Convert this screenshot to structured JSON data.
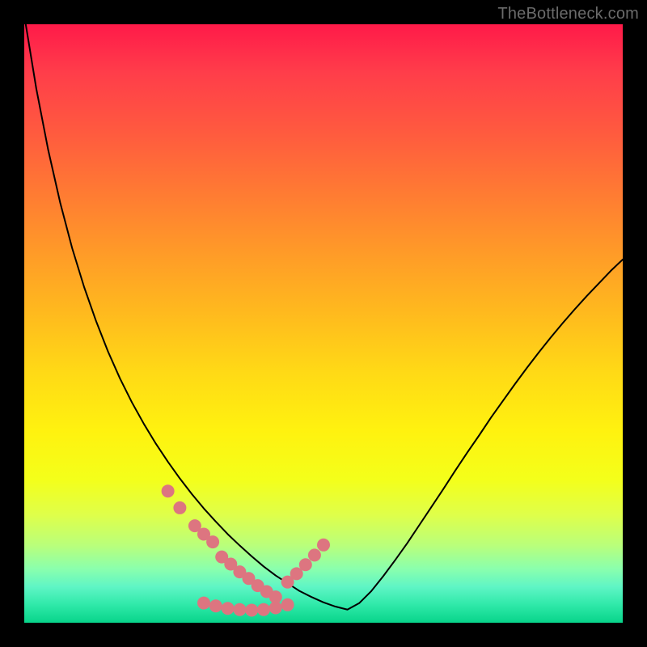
{
  "watermark": "TheBottleneck.com",
  "chart_data": {
    "type": "line",
    "title": "",
    "xlabel": "",
    "ylabel": "",
    "xlim": [
      0,
      1
    ],
    "ylim": [
      0,
      1
    ],
    "series": [
      {
        "name": "curve",
        "x": [
          0.0,
          0.02,
          0.04,
          0.06,
          0.08,
          0.1,
          0.12,
          0.14,
          0.16,
          0.18,
          0.2,
          0.22,
          0.24,
          0.26,
          0.28,
          0.3,
          0.32,
          0.34,
          0.36,
          0.38,
          0.4,
          0.42,
          0.44,
          0.46,
          0.48,
          0.5,
          0.52,
          0.54,
          0.56,
          0.58,
          0.6,
          0.62,
          0.64,
          0.66,
          0.68,
          0.7,
          0.72,
          0.74,
          0.76,
          0.78,
          0.8,
          0.82,
          0.84,
          0.86,
          0.88,
          0.9,
          0.92,
          0.94,
          0.96,
          0.98,
          1.0
        ],
        "y": [
          1.015,
          0.893,
          0.79,
          0.702,
          0.626,
          0.561,
          0.504,
          0.453,
          0.408,
          0.368,
          0.332,
          0.299,
          0.269,
          0.241,
          0.215,
          0.191,
          0.169,
          0.148,
          0.129,
          0.111,
          0.094,
          0.079,
          0.066,
          0.053,
          0.043,
          0.034,
          0.027,
          0.022,
          0.033,
          0.053,
          0.078,
          0.105,
          0.133,
          0.163,
          0.193,
          0.223,
          0.254,
          0.284,
          0.313,
          0.343,
          0.371,
          0.399,
          0.426,
          0.452,
          0.477,
          0.501,
          0.524,
          0.546,
          0.567,
          0.588,
          0.607
        ]
      },
      {
        "name": "highlight-left",
        "x": [
          0.24,
          0.26,
          0.285,
          0.3,
          0.315,
          0.33,
          0.345,
          0.36,
          0.375,
          0.39,
          0.405,
          0.42
        ],
        "y": [
          0.22,
          0.192,
          0.162,
          0.148,
          0.135,
          0.11,
          0.098,
          0.085,
          0.074,
          0.062,
          0.052,
          0.043
        ]
      },
      {
        "name": "highlight-bottom",
        "x": [
          0.3,
          0.32,
          0.34,
          0.36,
          0.38,
          0.4,
          0.42,
          0.44
        ],
        "y": [
          0.033,
          0.028,
          0.024,
          0.022,
          0.021,
          0.022,
          0.025,
          0.03
        ]
      },
      {
        "name": "highlight-right",
        "x": [
          0.44,
          0.455,
          0.47,
          0.485,
          0.5
        ],
        "y": [
          0.068,
          0.082,
          0.097,
          0.113,
          0.13
        ]
      }
    ],
    "highlight_color": "#dd7580",
    "curve_color": "#000000",
    "highlight_radius_px": 8
  }
}
